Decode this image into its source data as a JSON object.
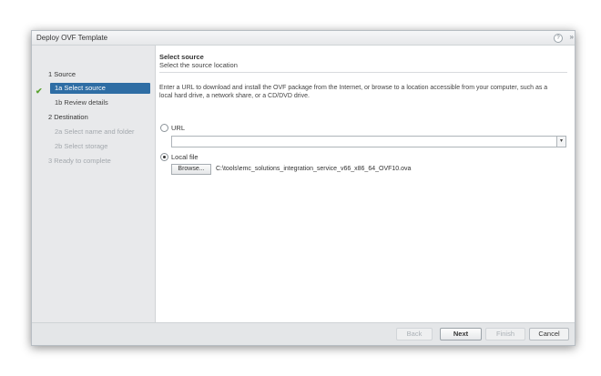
{
  "window": {
    "title": "Deploy OVF Template",
    "help_icon": "?",
    "expand_icon": "»"
  },
  "sidebar": {
    "steps": [
      {
        "label": "1  Source",
        "state": "normal"
      },
      {
        "label": "1a  Select source",
        "state": "selected"
      },
      {
        "label": "1b  Review details",
        "state": "normal"
      },
      {
        "label": "2  Destination",
        "state": "normal"
      },
      {
        "label": "2a  Select name and folder",
        "state": "disabled"
      },
      {
        "label": "2b  Select storage",
        "state": "disabled"
      },
      {
        "label": "3  Ready to complete",
        "state": "disabled"
      }
    ],
    "check_icon": "✔"
  },
  "main": {
    "title": "Select source",
    "subtitle": "Select the source location",
    "description": "Enter a URL to download and install the OVF package from the Internet, or browse to a location accessible from your computer, such as a local hard drive, a network share, or a CD/DVD drive.",
    "url_option_label": "URL",
    "url_value": "",
    "dropdown_icon": "▾",
    "local_option_label": "Local file",
    "selected_option": "local",
    "browse_label": "Browse...",
    "file_path": "C:\\tools\\emc_solutions_integration_service_v66_x86_64_OVF10.ova"
  },
  "footer": {
    "back_label": "Back",
    "next_label": "Next",
    "finish_label": "Finish",
    "cancel_label": "Cancel"
  },
  "colors": {
    "accent": "#2e6da4",
    "check": "#5aa22f",
    "sidebar_bg": "#e8e9eb"
  }
}
